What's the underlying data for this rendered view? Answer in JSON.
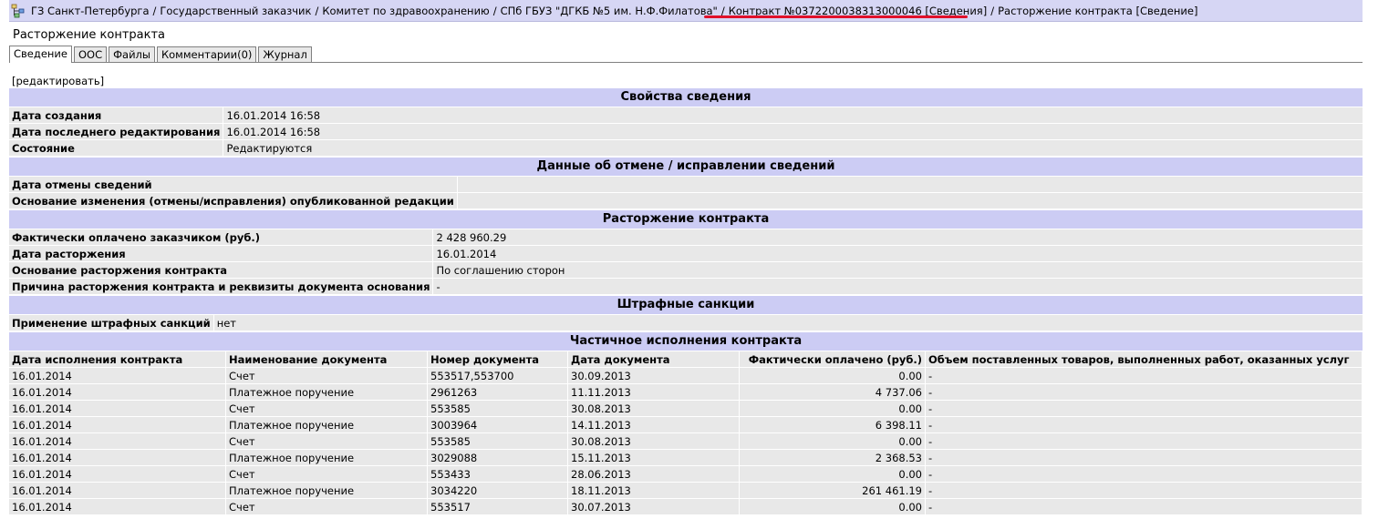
{
  "breadcrumb": {
    "items": [
      "ГЗ Санкт-Петербурга",
      "Государственный заказчик",
      "Комитет по здравоохранению",
      "СПб ГБУЗ \"ДГКБ №5 им. Н.Ф.Филатова\"",
      "Контракт №0372200038313000046 [Сведения]",
      "Расторжение контракта [Сведение]"
    ],
    "separator": "/",
    "icon": "tree-nav-icon",
    "highlight_color": "#e0102a"
  },
  "page": {
    "title": "Расторжение контракта",
    "tabs": [
      "Сведение",
      "ООС",
      "Файлы",
      "Комментарии(0)",
      "Журнал"
    ],
    "edit_label": "[редактировать]"
  },
  "sections": {
    "props": {
      "title": "Свойства сведения",
      "rows": [
        {
          "k": "Дата создания",
          "v": "16.01.2014 16:58"
        },
        {
          "k": "Дата последнего редактирования",
          "v": "16.01.2014 16:58"
        },
        {
          "k": "Состояние",
          "v": "Редактируются"
        }
      ]
    },
    "cancel": {
      "title": "Данные об отмене / исправлении сведений",
      "rows": [
        {
          "k": "Дата отмены сведений",
          "v": ""
        },
        {
          "k": "Основание изменения (отмены/исправления) опубликованной редакции",
          "v": ""
        }
      ]
    },
    "termination": {
      "title": "Расторжение контракта",
      "rows": [
        {
          "k": "Фактически оплачено заказчиком (руб.)",
          "v": "2 428 960.29"
        },
        {
          "k": "Дата расторжения",
          "v": "16.01.2014"
        },
        {
          "k": "Основание расторжения контракта",
          "v": "По соглашению сторон"
        },
        {
          "k": "Причина расторжения контракта и реквизиты документа основания",
          "v": "-"
        }
      ]
    },
    "penalties": {
      "title": "Штрафные санкции",
      "rows": [
        {
          "k": "Применение штрафных санкций",
          "v": "нет"
        }
      ]
    },
    "partial": {
      "title": "Частичное исполнения контракта",
      "columns": [
        "Дата исполнения контракта",
        "Наименование документа",
        "Номер документа",
        "Дата документа",
        "Фактически оплачено (руб.)",
        "Объем поставленных товаров, выполненных работ, оказанных услуг"
      ],
      "rows": [
        [
          "16.01.2014",
          "Счет",
          "553517,553700",
          "30.09.2013",
          "0.00",
          "-"
        ],
        [
          "16.01.2014",
          "Платежное поручение",
          "2961263",
          "11.11.2013",
          "4 737.06",
          "-"
        ],
        [
          "16.01.2014",
          "Счет",
          "553585",
          "30.08.2013",
          "0.00",
          "-"
        ],
        [
          "16.01.2014",
          "Платежное поручение",
          "3003964",
          "14.11.2013",
          "6 398.11",
          "-"
        ],
        [
          "16.01.2014",
          "Счет",
          "553585",
          "30.08.2013",
          "0.00",
          "-"
        ],
        [
          "16.01.2014",
          "Платежное поручение",
          "3029088",
          "15.11.2013",
          "2 368.53",
          "-"
        ],
        [
          "16.01.2014",
          "Счет",
          "553433",
          "28.06.2013",
          "0.00",
          "-"
        ],
        [
          "16.01.2014",
          "Платежное поручение",
          "3034220",
          "18.11.2013",
          "261 461.19",
          "-"
        ],
        [
          "16.01.2014",
          "Счет",
          "553517",
          "30.07.2013",
          "0.00",
          "-"
        ]
      ]
    }
  }
}
